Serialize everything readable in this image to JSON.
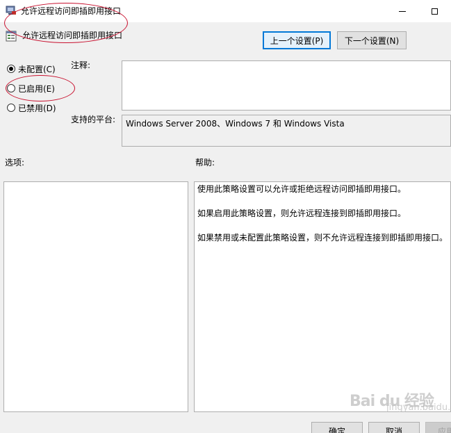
{
  "window": {
    "title": "允许远程访问即插即用接口",
    "minimize_icon": "minimize-icon",
    "maximize_icon": "maximize-icon"
  },
  "header": {
    "policy_name": "允许远程访问即插即用接口",
    "prev_label": "上一个设置(P)",
    "next_label": "下一个设置(N)"
  },
  "state_options": [
    {
      "label": "未配置(C)",
      "checked": true
    },
    {
      "label": "已启用(E)",
      "checked": false
    },
    {
      "label": "已禁用(D)",
      "checked": false
    }
  ],
  "comment": {
    "label": "注释:",
    "value": ""
  },
  "platform": {
    "label": "支持的平台:",
    "value": "Windows Server 2008、Windows 7 和 Windows Vista"
  },
  "options": {
    "label": "选项:"
  },
  "help": {
    "label": "帮助:",
    "paragraphs": [
      "使用此策略设置可以允许或拒绝远程访问即插即用接口。",
      "如果启用此策略设置，则允许远程连接到即插即用接口。",
      "如果禁用或未配置此策略设置，则不允许远程连接到即插即用接口。"
    ]
  },
  "footer": {
    "ok_label": "确定",
    "cancel_label": "取消",
    "apply_label": "应用"
  },
  "watermark": {
    "text": "Bai du 经验",
    "sub": "jingyan.baidu.com"
  },
  "colors": {
    "annotation": "#c8102e",
    "focus_border": "#0078d7"
  }
}
